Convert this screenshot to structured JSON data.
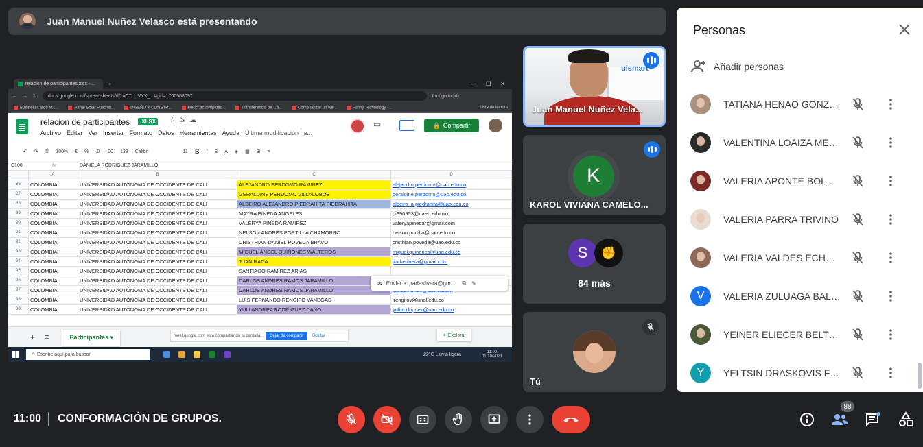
{
  "banner": {
    "presenter_text": "Juan Manuel Nuñez Velasco está presentando"
  },
  "shared_screen": {
    "browser_tab": "relacion de participantes.xlsx - ...",
    "url": "docs.google.com/spreadsheets/d/1nCTLUVYX_...#gid=1700568097",
    "incognito": "Incógnito (4)",
    "bookmarks": [
      "BusinessCardo MX...",
      "Panel Solar Policrist...",
      "DISEÑO Y CONSTR...",
      "eieucr.ac.cr/upload...",
      "Transferencia de Ca...",
      "Cómo lanzar un we...",
      "Funny Technology -..."
    ],
    "reading_list": "Lista de lectura",
    "sheet_title": "relacion de participantes",
    "file_badge": ".XLSX",
    "menu": [
      "Archivo",
      "Editar",
      "Ver",
      "Insertar",
      "Formato",
      "Datos",
      "Herramientas",
      "Ayuda"
    ],
    "last_edit": "Última modificación ha...",
    "share_label": "Compartir",
    "toolbar": [
      "100%",
      "€",
      "%",
      ".0",
      ".00",
      "123",
      "Calibri",
      "11"
    ],
    "cell_ref": "C100",
    "formula_value": "DANIELA RODRIGUEZ JARAMILLO",
    "columns": [
      "A",
      "B",
      "C",
      "D"
    ],
    "rows": [
      {
        "n": "86",
        "a": "COLOMBIA",
        "b": "UNIVERSIDAD AUTÓNOMA DE OCCIDENTE DE CALI",
        "c": "ALEJANDRO PERDOMO RAMIREZ",
        "d": "alejandro.perdomo@uao.edu.co",
        "hl": "#fff200",
        "link": true
      },
      {
        "n": "87",
        "a": "COLOMBIA",
        "b": "UNIVERSIDAD AUTÓNOMA DE OCCIDENTE DE CALI",
        "c": "GERALDINE PERDOMO VILLALOBOS",
        "d": "geraldine.perdomo@uao.edu.co",
        "hl": "#fff200",
        "link": true
      },
      {
        "n": "88",
        "a": "COLOMBIA",
        "b": "UNIVERSIDAD AUTÓNOMA DE OCCIDENTE DE CALI",
        "c": "ALBEIRO ALEJANDRO PIEDRAHITA PIEDRAHITA",
        "d": "albeiro_a.piedrahita@uao.edu.co",
        "hl": "#9fb5e0",
        "link": true
      },
      {
        "n": "89",
        "a": "COLOMBIA",
        "b": "UNIVERSIDAD AUTÓNOMA DE OCCIDENTE DE CALI",
        "c": "MAYRA PINEDA ANGELES",
        "d": "pi390953@uaeh.edu.mx",
        "hl": "",
        "link": false
      },
      {
        "n": "90",
        "a": "COLOMBIA",
        "b": "UNIVERSIDAD AUTÓNOMA DE OCCIDENTE DE CALI",
        "c": "VALERYA PINEDA RAMIREZ",
        "d": "valeryapinedar@gmail.com",
        "hl": "",
        "link": false
      },
      {
        "n": "91",
        "a": "COLOMBIA",
        "b": "UNIVERSIDAD AUTÓNOMA DE OCCIDENTE DE CALI",
        "c": "NELSON ANDRÉS PORTILLA CHAMORRO",
        "d": "nelson.portilla@uao.edu.co",
        "hl": "",
        "link": false
      },
      {
        "n": "92",
        "a": "COLOMBIA",
        "b": "UNIVERSIDAD AUTÓNOMA DE OCCIDENTE DE CALI",
        "c": "CRISTHIAN DANIEL POVEDA BRAVO",
        "d": "cristhian.poveda@uao.edu.co",
        "hl": "",
        "link": false
      },
      {
        "n": "93",
        "a": "COLOMBIA",
        "b": "UNIVERSIDAD AUTÓNOMA DE OCCIDENTE DE CALI",
        "c": "MIGUEL ÁNGEL QUIÑONES WALTEROS",
        "d": "miguel.quinones@uao.edu.co",
        "hl": "#b4a7d6",
        "link": true
      },
      {
        "n": "94",
        "a": "COLOMBIA",
        "b": "UNIVERSIDAD AUTÓNOMA DE OCCIDENTE DE CALI",
        "c": "JUAN RADA",
        "d": "jradasilvera@gmail.com",
        "hl": "#fff200",
        "link": true
      },
      {
        "n": "95",
        "a": "COLOMBIA",
        "b": "UNIVERSIDAD AUTÓNOMA DE OCCIDENTE DE CALI",
        "c": "SANTIAGO RAMÍREZ ARIAS",
        "d": "",
        "hl": "",
        "link": false
      },
      {
        "n": "96",
        "a": "COLOMBIA",
        "b": "UNIVERSIDAD AUTÓNOMA DE OCCIDENTE DE CALI",
        "c": "CARLOS ANDRES RAMOS JARAMILLO",
        "d": "",
        "hl": "#b4a7d6",
        "link": false
      },
      {
        "n": "97",
        "a": "COLOMBIA",
        "b": "UNIVERSIDAD AUTÓNOMA DE OCCIDENTE DE CALI",
        "c": "CARLOS ANDRES RAMOS JARAMILLO",
        "d": "carlos.ramos@uao.edu.co",
        "hl": "#b4a7d6",
        "link": true
      },
      {
        "n": "98",
        "a": "COLOMBIA",
        "b": "UNIVERSIDAD AUTÓNOMA DE OCCIDENTE DE CALI",
        "c": "LUIS FERNANDO RENGIFO VANEGAS",
        "d": "lrengifov@unal.edu.co",
        "hl": "",
        "link": false
      },
      {
        "n": "99",
        "a": "COLOMBIA",
        "b": "UNIVERSIDAD AUTÓNOMA DE OCCIDENTE DE CALI",
        "c": "YULI ANDREA RODRÍGUEZ CANO",
        "d": "yuli.rodriguez@uao.edu.co",
        "hl": "#b4a7d6",
        "link": true
      }
    ],
    "email_popup": "Enviar a: jradasilvera@gm...",
    "sheet_tab": "Participantes",
    "share_notice": "meet.google.com está compartiendo tu pantalla.",
    "stop_sharing": "Dejar de compartir",
    "hide": "Ocultar",
    "explore": "Explorar",
    "taskbar_search": "Escribe aquí para buscar",
    "weather": "22°C  Lluvia ligera",
    "clock_time": "11:00",
    "clock_date": "01/10/2021"
  },
  "tiles": {
    "juan": {
      "name": "Juan Manuel Nuñez Vela...",
      "backdrop_logo": "uismart"
    },
    "karol": {
      "initial": "K",
      "name": "KAROL VIVIANA CAMELO..."
    },
    "more": {
      "initial": "S",
      "label": "84 más"
    },
    "you": {
      "name": "Tú"
    }
  },
  "panel": {
    "title": "Personas",
    "add_people": "Añadir personas",
    "people": [
      {
        "name": "TATIANA HENAO GONZA...",
        "avatar": "photo",
        "color": "#a89080"
      },
      {
        "name": "VALENTINA LOAIZA MEJIA",
        "avatar": "photo",
        "color": "#2a2a2a"
      },
      {
        "name": "VALERIA APONTE BOLAN...",
        "avatar": "photo",
        "color": "#7a2a2a"
      },
      {
        "name": "VALERIA PARRA TRIVINO",
        "avatar": "photo",
        "color": "#e6dcd4"
      },
      {
        "name": "VALERIA VALDES ECHEVE...",
        "avatar": "photo",
        "color": "#8c6a55"
      },
      {
        "name": "VALERIA ZULUAGA BALL...",
        "avatar": "V",
        "color": "#1a73e8"
      },
      {
        "name": "YEINER ELIECER BELTRAN...",
        "avatar": "photo",
        "color": "#4a5a3a"
      },
      {
        "name": "YELTSIN DRASKOVIS FRA...",
        "avatar": "Y",
        "color": "#129eaf"
      }
    ]
  },
  "bottom_bar": {
    "time": "11:00",
    "meeting_name": "CONFORMACIÓN DE GRUPOS.",
    "people_count": "88"
  },
  "colors": {
    "red": "#ea4335",
    "dark": "#202124",
    "tile": "#3c4043",
    "accent": "#8ab4f8"
  }
}
